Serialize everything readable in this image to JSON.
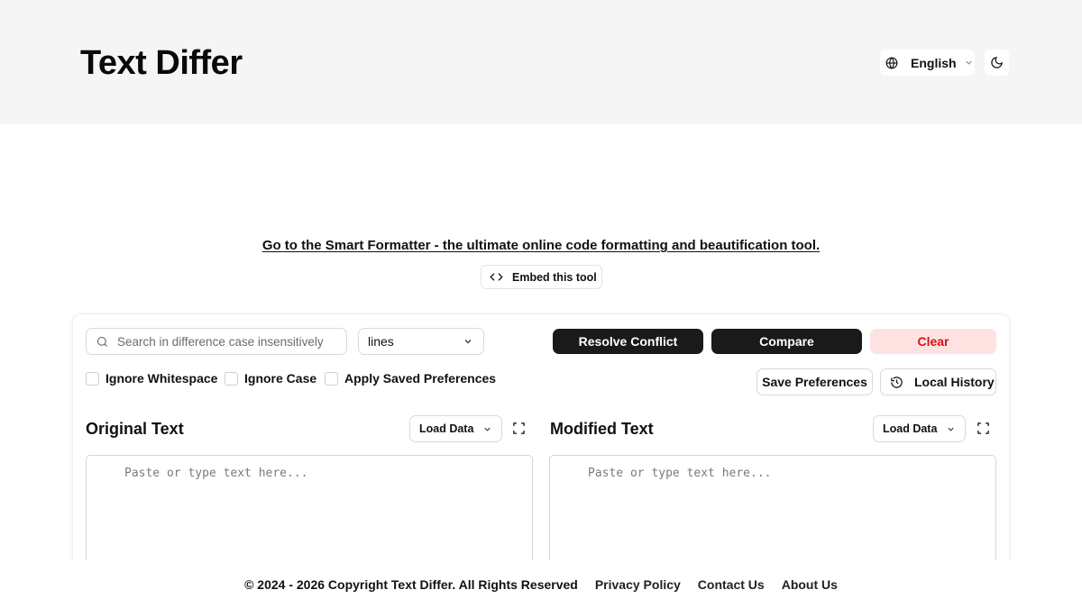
{
  "header": {
    "site_title": "Text Differ",
    "language_label": "English",
    "language_icon": "globe-icon",
    "theme_icon": "moon-icon"
  },
  "promo": {
    "link_text": "Go to the Smart Formatter - the ultimate online code formatting and beautification tool.",
    "embed_label": "Embed this tool"
  },
  "toolbar": {
    "search_placeholder": "Search in difference case insensitively",
    "mode_value": "lines",
    "resolve_label": "Resolve Conflict",
    "compare_label": "Compare",
    "clear_label": "Clear",
    "clear_color": "#d4141a",
    "options": [
      {
        "label": "Ignore Whitespace",
        "checked": false
      },
      {
        "label": "Ignore Case",
        "checked": false
      },
      {
        "label": "Apply Saved Preferences",
        "checked": false
      }
    ],
    "save_prefs_label": "Save Preferences",
    "history_label": "Local History"
  },
  "panes": {
    "original": {
      "title": "Original Text",
      "load_label": "Load Data",
      "placeholder": "Paste or type text here..."
    },
    "modified": {
      "title": "Modified Text",
      "load_label": "Load Data",
      "placeholder": "Paste or type text here..."
    }
  },
  "footer": {
    "copyright": "© 2024 - 2026 Copyright Text Differ. All Rights Reserved",
    "links": [
      "Privacy Policy",
      "Contact Us",
      "About Us"
    ]
  }
}
